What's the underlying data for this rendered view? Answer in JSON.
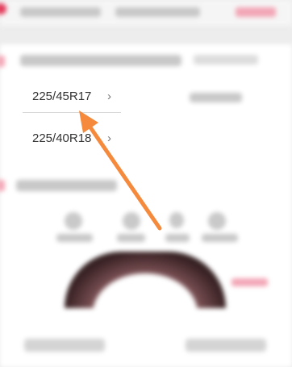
{
  "tire_sizes": [
    {
      "size": "225/45R17",
      "chevron": "›"
    },
    {
      "size": "225/40R18",
      "chevron": "›"
    }
  ],
  "arrow_color": "#f58a3c",
  "accent_color": "#e23b5a"
}
